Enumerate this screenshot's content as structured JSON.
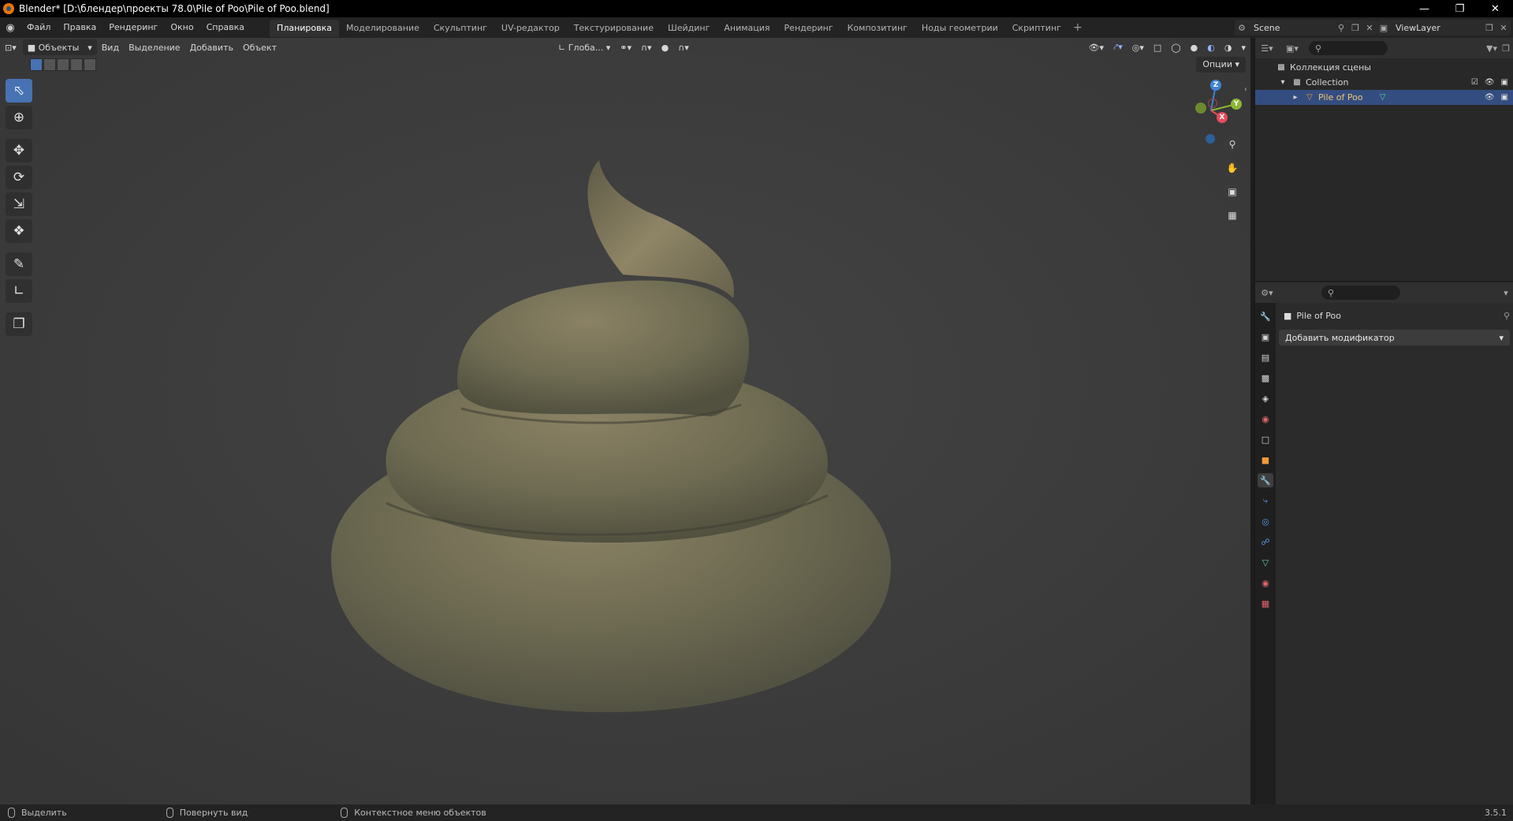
{
  "window": {
    "title": "Blender* [D:\\блендер\\проекты 78.0\\Pile of Poo\\Pile of Poo.blend]",
    "controls": [
      "minimize",
      "restore",
      "close"
    ]
  },
  "menu": {
    "items": [
      "Файл",
      "Правка",
      "Рендеринг",
      "Окно",
      "Справка"
    ]
  },
  "workspaces": {
    "tabs": [
      "Планировка",
      "Моделирование",
      "Скульптинг",
      "UV-редактор",
      "Текстурирование",
      "Шейдинг",
      "Анимация",
      "Рендеринг",
      "Композитинг",
      "Ноды геометрии",
      "Скриптинг"
    ],
    "active": "Планировка",
    "add": "+"
  },
  "scene": {
    "name": "Scene"
  },
  "view_layer": {
    "name": "ViewLayer"
  },
  "viewport": {
    "mode": "Объекты",
    "menus": [
      "Вид",
      "Выделение",
      "Добавить",
      "Объект"
    ],
    "transform_orientation": "Глоба...",
    "options_label": "Опции",
    "shading_mode": "solid",
    "gizmo_axes": {
      "x": "X",
      "y": "Y",
      "z": "Z"
    },
    "model_name": "Pile of Poo"
  },
  "toolbar": {
    "tools": [
      "select-box",
      "cursor",
      "move",
      "rotate",
      "scale",
      "transform",
      "annotate",
      "measure",
      "add-cube"
    ],
    "active": "select-box"
  },
  "outliner": {
    "search_placeholder": "",
    "root": "Коллекция сцены",
    "collection": "Collection",
    "object": "Pile of Poo"
  },
  "properties": {
    "object_name": "Pile of Poo",
    "add_modifier_label": "Добавить модификатор",
    "active_tab": "modifiers"
  },
  "statusbar": {
    "select": "Выделить",
    "rotate_view": "Повернуть вид",
    "context_menu": "Контекстное меню объектов",
    "version": "3.5.1"
  },
  "colors": {
    "accent": "#4772b3",
    "model_base": "#6e6b52",
    "viewport_bg": "#3d3d3d",
    "axis_x": "#e74c5a",
    "axis_y": "#8ab833",
    "axis_z": "#3e84d6"
  }
}
